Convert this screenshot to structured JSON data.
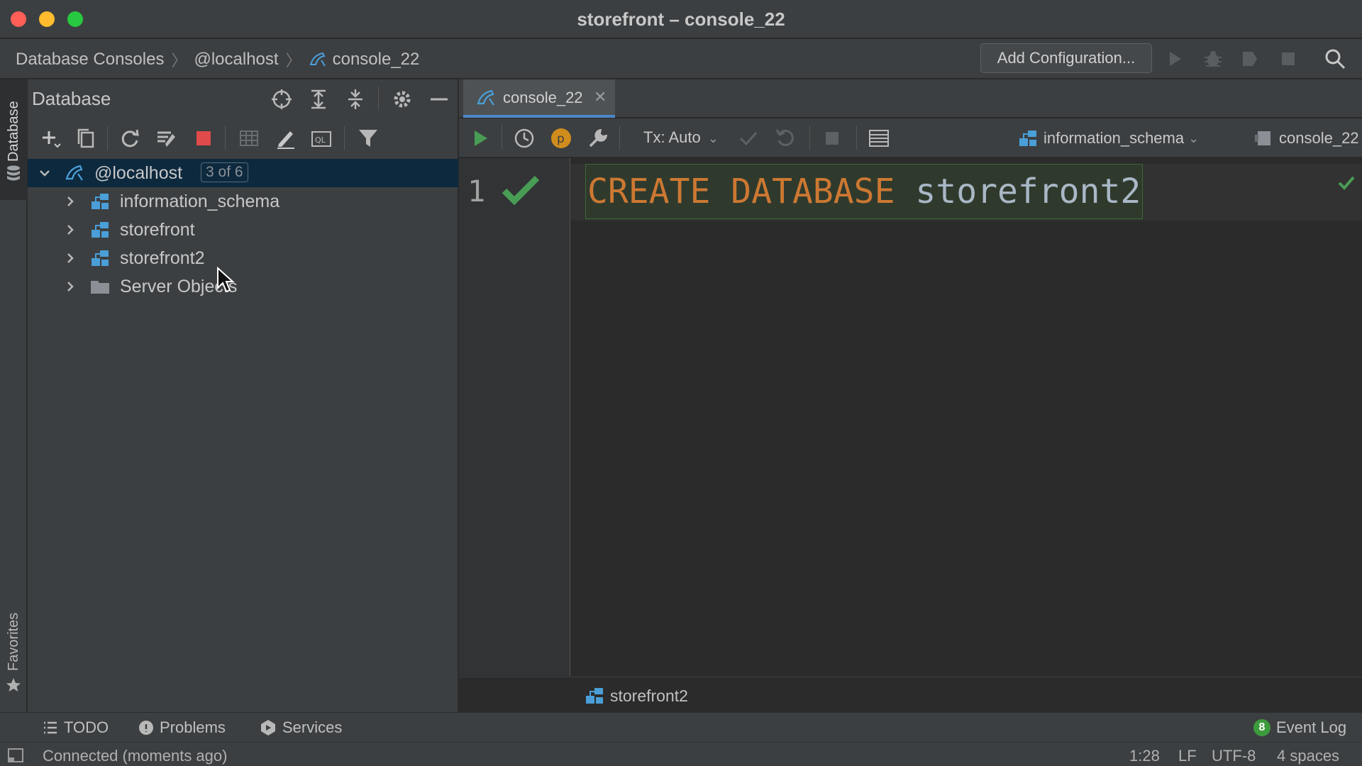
{
  "window": {
    "title": "storefront – console_22"
  },
  "breadcrumb": [
    "Database Consoles",
    "@localhost",
    "console_22"
  ],
  "toolbar": {
    "add_configuration": "Add Configuration..."
  },
  "sidebar": {
    "database_tab": "Database",
    "favorites_tab": "Favorites"
  },
  "db_panel": {
    "title": "Database",
    "tree": {
      "root": {
        "label": "@localhost",
        "badge": "3 of 6"
      },
      "children": [
        {
          "label": "information_schema"
        },
        {
          "label": "storefront"
        },
        {
          "label": "storefront2"
        },
        {
          "label": "Server Objects"
        }
      ]
    }
  },
  "editor": {
    "tab_label": "console_22",
    "tx_mode": "Tx: Auto",
    "schema": "information_schema",
    "session": "console_22",
    "line_number": "1",
    "code_keyword": "CREATE DATABASE",
    "code_identifier": "storefront2",
    "breadcrumb_db": "storefront2"
  },
  "bottom_tools": {
    "todo": "TODO",
    "problems": "Problems",
    "services": "Services",
    "event_log": "Event Log",
    "event_count": "8"
  },
  "status": {
    "message": "Connected (moments ago)",
    "position": "1:28",
    "line_sep": "LF",
    "encoding": "UTF-8",
    "indent": "4 spaces"
  },
  "colors": {
    "accent": "#4a88c7",
    "run_green": "#499c54",
    "stop_red": "#e04a4a",
    "keyword": "#cc7832",
    "selection": "#0d293e"
  }
}
